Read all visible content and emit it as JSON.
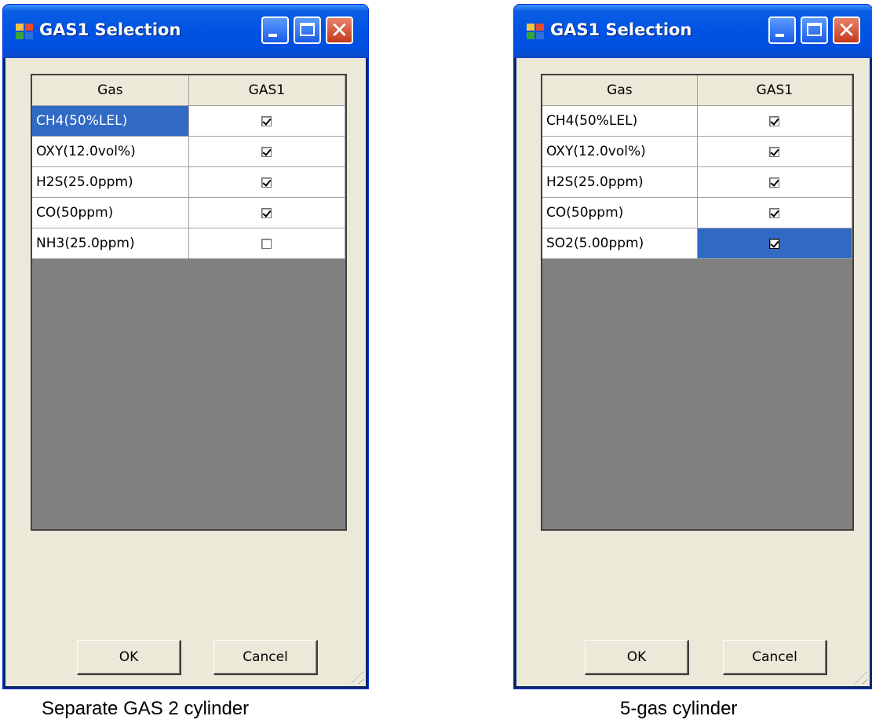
{
  "windows": [
    {
      "title": "GAS1 Selection",
      "grid": {
        "columns": [
          "Gas",
          "GAS1"
        ],
        "rows": [
          {
            "gas": "CH4(50%LEL)",
            "checked": true,
            "selected_cell": "gas"
          },
          {
            "gas": "OXY(12.0vol%)",
            "checked": true,
            "selected_cell": null
          },
          {
            "gas": "H2S(25.0ppm)",
            "checked": true,
            "selected_cell": null
          },
          {
            "gas": "CO(50ppm)",
            "checked": true,
            "selected_cell": null
          },
          {
            "gas": "NH3(25.0ppm)",
            "checked": false,
            "selected_cell": null
          }
        ]
      },
      "buttons": {
        "ok": "OK",
        "cancel": "Cancel"
      },
      "caption": "Separate GAS 2 cylinder"
    },
    {
      "title": "GAS1 Selection",
      "grid": {
        "columns": [
          "Gas",
          "GAS1"
        ],
        "rows": [
          {
            "gas": "CH4(50%LEL)",
            "checked": true,
            "selected_cell": null
          },
          {
            "gas": "OXY(12.0vol%)",
            "checked": true,
            "selected_cell": null
          },
          {
            "gas": "H2S(25.0ppm)",
            "checked": true,
            "selected_cell": null
          },
          {
            "gas": "CO(50ppm)",
            "checked": true,
            "selected_cell": null
          },
          {
            "gas": "SO2(5.00ppm)",
            "checked": true,
            "selected_cell": "check"
          }
        ]
      },
      "buttons": {
        "ok": "OK",
        "cancel": "Cancel"
      },
      "caption": "5-gas cylinder"
    }
  ],
  "colors": {
    "titlebar": "#0054e3",
    "selection": "#316ac5",
    "grid_background": "#808080",
    "dialog_background": "#ece9d8"
  }
}
